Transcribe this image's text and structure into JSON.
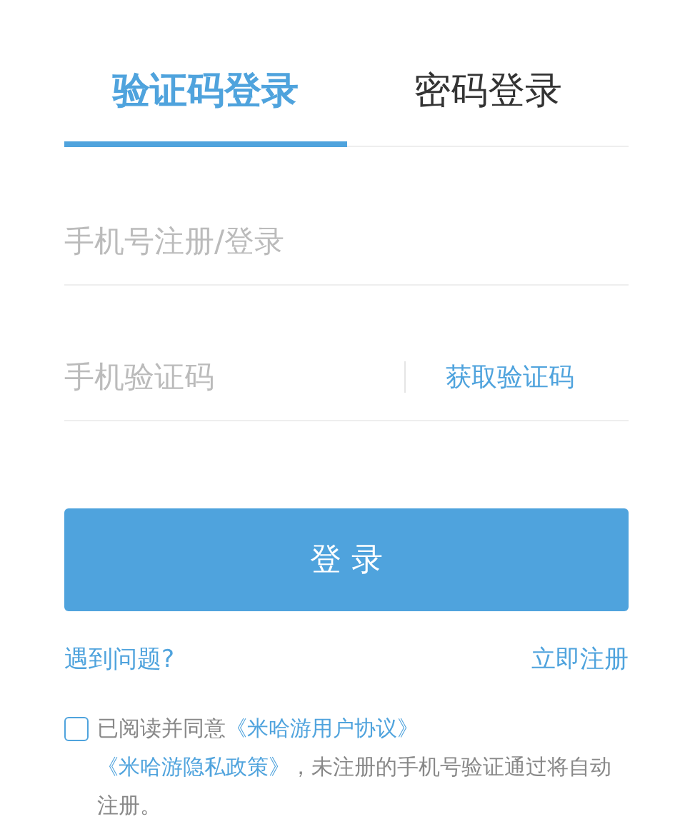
{
  "tabs": [
    {
      "label": "验证码登录",
      "selected": true
    },
    {
      "label": "密码登录",
      "selected": false
    }
  ],
  "phone_field": {
    "placeholder": "手机号注册/登录"
  },
  "code_field": {
    "placeholder": "手机验证码",
    "action": "获取验证码"
  },
  "login_button": "登 录",
  "help_link": "遇到问题?",
  "register_link": "立即注册",
  "agreement": {
    "checked": false,
    "parts": [
      {
        "kind": "plain",
        "text": "已阅读并同意"
      },
      {
        "kind": "link",
        "text": "《米哈游用户协议》"
      },
      {
        "kind": "link",
        "text": "《米哈游隐私政策》"
      },
      {
        "kind": "plain",
        "text": "，未注册的手机号验证通过将自动注册。"
      }
    ]
  }
}
